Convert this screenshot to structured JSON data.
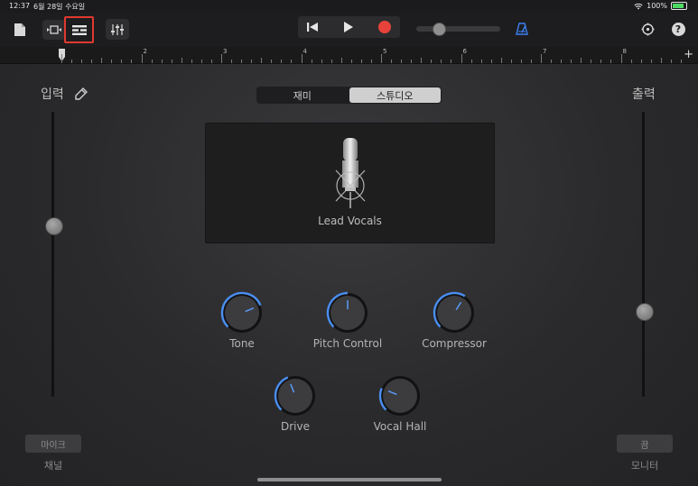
{
  "status": {
    "time": "12:37",
    "date": "6월 28일 수요일",
    "battery": "100%"
  },
  "toolbar": {
    "highlight_color": "#e0392f",
    "record_color": "#e8433a",
    "metronome_color": "#3b82f6"
  },
  "ruler": {
    "marks": [
      "2",
      "3",
      "4",
      "5",
      "6",
      "7",
      "8"
    ],
    "add_label": "+"
  },
  "input": {
    "label": "입력",
    "level": 0.6
  },
  "output": {
    "label": "출력",
    "level": 0.3
  },
  "tabs": {
    "fun": "재미",
    "studio": "스튜디오"
  },
  "instrument": {
    "name": "Lead Vocals"
  },
  "knobs": [
    {
      "label": "Tone",
      "value": 0.75
    },
    {
      "label": "Pitch Control",
      "value": 0.5
    },
    {
      "label": "Compressor",
      "value": 0.62
    },
    {
      "label": "Drive",
      "value": 0.42
    },
    {
      "label": "Vocal Hall",
      "value": 0.25
    }
  ],
  "bottom_left": {
    "button": "마이크",
    "caption": "채널"
  },
  "bottom_right": {
    "button": "끔",
    "caption": "모니터"
  }
}
